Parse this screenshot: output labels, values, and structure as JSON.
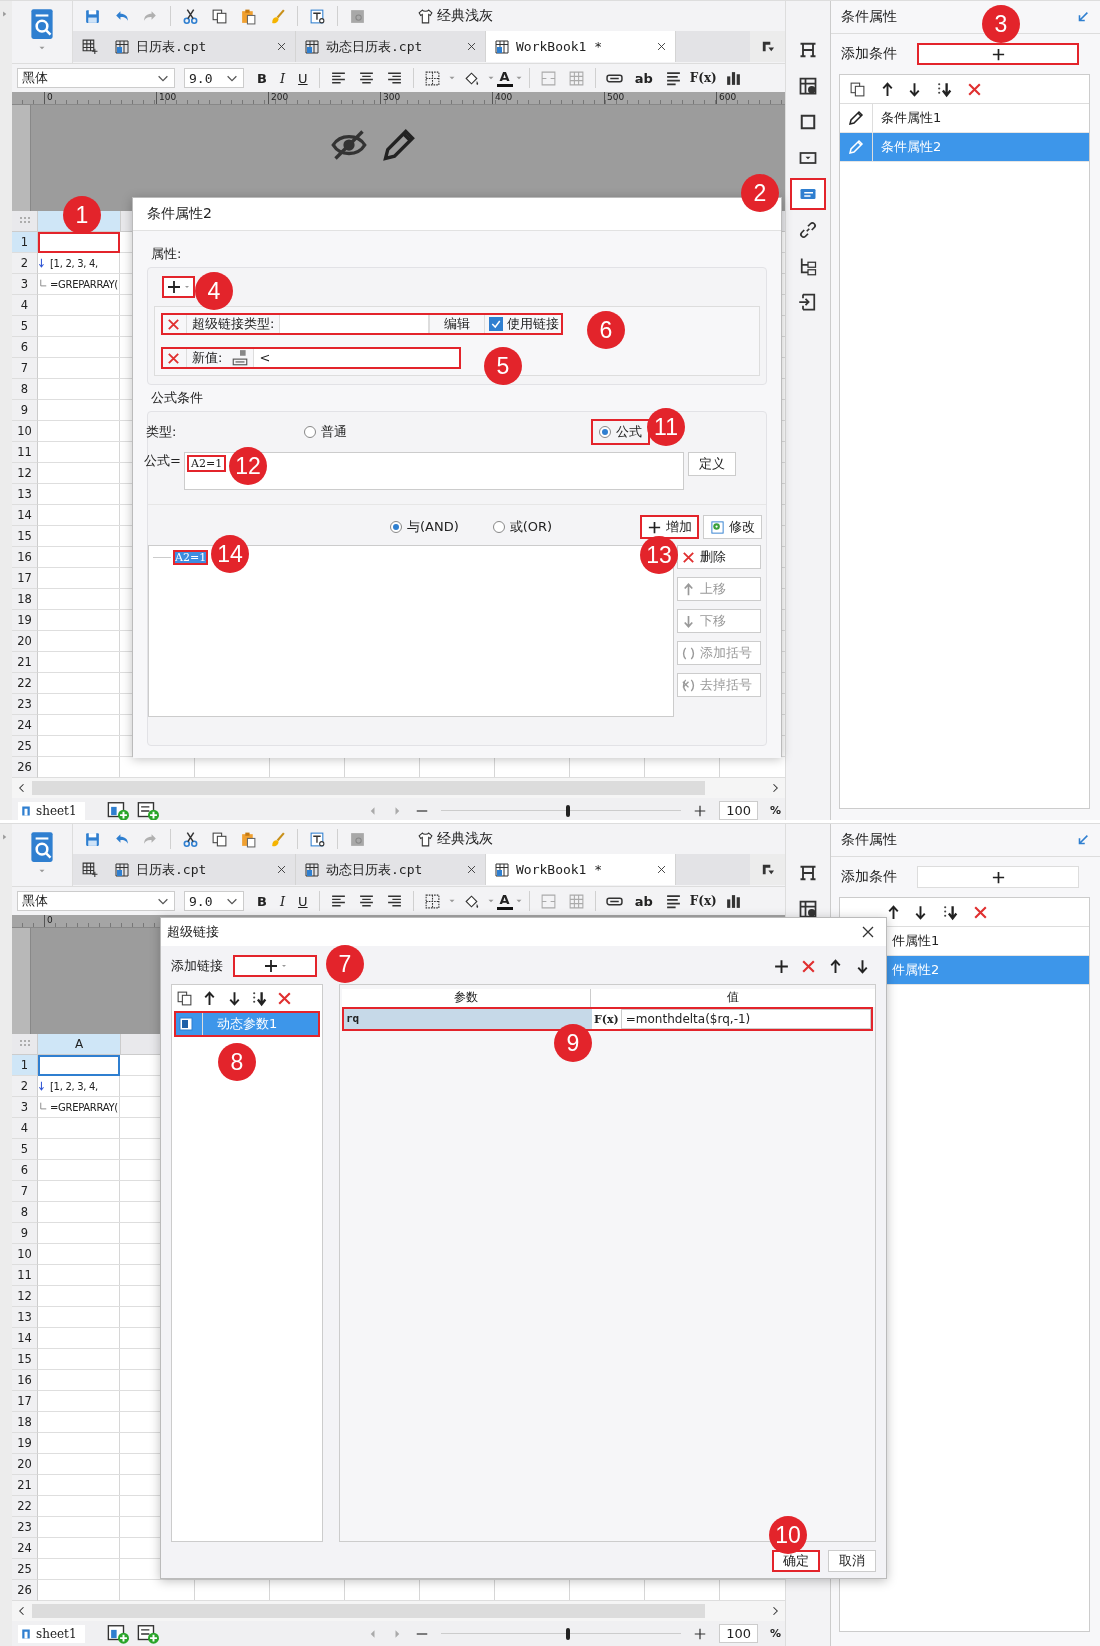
{
  "screens": [
    {
      "toolbar": {
        "theme_label": "经典浅灰"
      },
      "tabs": [
        {
          "label": "日历表.cpt",
          "selected": false
        },
        {
          "label": "动态日历表.cpt",
          "selected": false
        },
        {
          "label": "WorkBook1 *",
          "selected": true
        }
      ],
      "format_bar": {
        "font": "黑体",
        "size": "9.0",
        "styles": [
          "B",
          "I",
          "U"
        ],
        "font_color_label": "A",
        "text_label": "ab",
        "formula_label": "F(x)"
      },
      "ruler": [
        "0",
        "100",
        "200",
        "300",
        "400",
        "500",
        "600"
      ],
      "canvas_icons": true,
      "grid": {
        "row_numbers": [
          "1",
          "2",
          "3",
          "4",
          "5",
          "6",
          "7",
          "8",
          "9",
          "10",
          "11",
          "12",
          "13",
          "14",
          "15",
          "16",
          "17",
          "18",
          "19",
          "20",
          "21",
          "22",
          "23",
          "24",
          "25",
          "26"
        ],
        "cells": [
          "[1, 2, 3, 4,",
          "=GREPARRAY("
        ],
        "selected_cell_highlighted": true
      },
      "icon_strip": [
        {
          "kind": "frame",
          "highlighted": false
        },
        {
          "kind": "cellinfo",
          "highlighted": false
        },
        {
          "kind": "rect",
          "highlighted": false
        },
        {
          "kind": "widget",
          "highlighted": false
        },
        {
          "kind": "condition",
          "highlighted": true
        },
        {
          "kind": "link",
          "highlighted": false
        },
        {
          "kind": "tree",
          "highlighted": false
        },
        {
          "kind": "export",
          "highlighted": false
        }
      ],
      "right_panel": {
        "title": "条件属性",
        "add_label": "添加条件",
        "add_highlighted": true,
        "covered_left": false,
        "items": [
          {
            "label": "条件属性1",
            "selected": false
          },
          {
            "label": "条件属性2",
            "selected": true
          }
        ]
      },
      "status_bar": {
        "sheet": "sheet1",
        "zoom": "100",
        "unit": "%",
        "level": 0.53
      },
      "dialog": {
        "kind": "condition",
        "title": "条件属性2",
        "properties_label": "属性:",
        "add_highlighted": true,
        "properties": [
          {
            "kind": "hyperlink",
            "label": "超级链接类型:",
            "edit": "编辑",
            "checkbox_label": "使用链接",
            "checked": true,
            "highlighted": true
          },
          {
            "kind": "value",
            "label": "新值:",
            "value": "<",
            "highlighted": true
          }
        ],
        "formula_section": "公式条件",
        "type_label": "类型:",
        "types": [
          {
            "label": "普通",
            "selected": false,
            "highlighted": false
          },
          {
            "label": "公式",
            "selected": true,
            "highlighted": true
          }
        ],
        "formula_label": "公式=",
        "formula": "A2=1",
        "formula_highlighted": true,
        "define": "定义",
        "logic": [
          {
            "label": "与(AND)",
            "selected": true
          },
          {
            "label": "或(OR)",
            "selected": false
          }
        ],
        "buttons": [
          {
            "label": "增加",
            "kind": "plus",
            "disabled": false,
            "highlighted": true
          },
          {
            "label": "修改",
            "kind": "edit",
            "disabled": false,
            "highlighted": false
          },
          {
            "label": "删除",
            "kind": "delete",
            "disabled": false,
            "highlighted": false
          },
          {
            "label": "上移",
            "kind": "up",
            "disabled": true,
            "highlighted": false
          },
          {
            "label": "下移",
            "kind": "down",
            "disabled": true,
            "highlighted": false
          },
          {
            "label": "添加括号",
            "kind": "brackets",
            "disabled": true,
            "highlighted": false
          },
          {
            "label": "去掉括号",
            "kind": "unbrackets",
            "disabled": true,
            "highlighted": false
          }
        ],
        "conditions": [
          {
            "text": "A2=1",
            "selected": true,
            "highlighted": true
          }
        ]
      },
      "callouts": [
        "1",
        "2",
        "3",
        "4",
        "5",
        "6",
        "11",
        "12",
        "13",
        "14"
      ]
    },
    {
      "toolbar": {
        "theme_label": "经典浅灰"
      },
      "tabs": [
        {
          "label": "日历表.cpt",
          "selected": false
        },
        {
          "label": "动态日历表.cpt",
          "selected": false
        },
        {
          "label": "WorkBook1 *",
          "selected": true
        }
      ],
      "format_bar": {
        "font": "黑体",
        "size": "9.0",
        "styles": [
          "B",
          "I",
          "U"
        ],
        "font_color_label": "A",
        "text_label": "ab",
        "formula_label": "F(x)"
      },
      "ruler": [
        "0"
      ],
      "canvas_icons": false,
      "grid": {
        "column_header": "A",
        "row_numbers": [
          "1",
          "2",
          "3",
          "4",
          "5",
          "6",
          "7",
          "8",
          "9",
          "10",
          "11",
          "12",
          "13",
          "14",
          "15",
          "16",
          "17",
          "18",
          "19",
          "20",
          "21",
          "22",
          "23",
          "24",
          "25",
          "26"
        ],
        "cells": [
          "[1, 2, 3, 4,",
          "=GREPARRAY("
        ],
        "selected_cell_highlighted": false
      },
      "icon_strip": [
        {
          "kind": "frame",
          "highlighted": false
        },
        {
          "kind": "cellinfo",
          "highlighted": false
        }
      ],
      "right_panel": {
        "title": "条件属性",
        "add_label": "添加条件",
        "add_highlighted": false,
        "covered_left": true,
        "items": [
          {
            "label": "件属性1",
            "selected": false
          },
          {
            "label": "件属性2",
            "selected": true
          }
        ]
      },
      "status_bar": {
        "sheet": "sheet1",
        "zoom": "100",
        "unit": "%",
        "level": 0.53
      },
      "dialog": {
        "kind": "hyperlink",
        "title": "超级链接",
        "add_label": "添加链接",
        "add_highlighted": true,
        "links": [
          {
            "label": "动态参数1",
            "selected": true,
            "highlighted": true
          }
        ],
        "columns": [
          "参数",
          "值"
        ],
        "params": [
          {
            "name": "rq",
            "fx": "F(x)",
            "value": "=monthdelta($rq,-1)",
            "highlighted": true
          }
        ],
        "buttons": [
          {
            "label": "确定",
            "highlighted": true
          },
          {
            "label": "取消",
            "highlighted": false
          }
        ]
      },
      "callouts": [
        "7",
        "8",
        "9",
        "10"
      ]
    }
  ]
}
